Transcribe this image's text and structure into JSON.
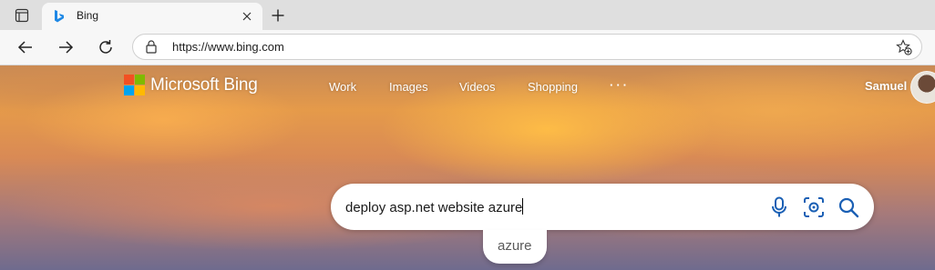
{
  "tab": {
    "title": "Bing"
  },
  "toolbar": {
    "url": "https://www.bing.com"
  },
  "header": {
    "logo_text": "Microsoft Bing",
    "nav": [
      "Work",
      "Images",
      "Videos",
      "Shopping"
    ],
    "more": "···",
    "username": "Samuel"
  },
  "search": {
    "query": "deploy asp.net website azure"
  },
  "suggestions": [
    "azure"
  ],
  "colors": {
    "bing_blue": "#1a5fb4",
    "logo_red": "#f25022",
    "logo_green": "#7fba00",
    "logo_blue": "#00a4ef",
    "logo_yellow": "#ffb900"
  }
}
